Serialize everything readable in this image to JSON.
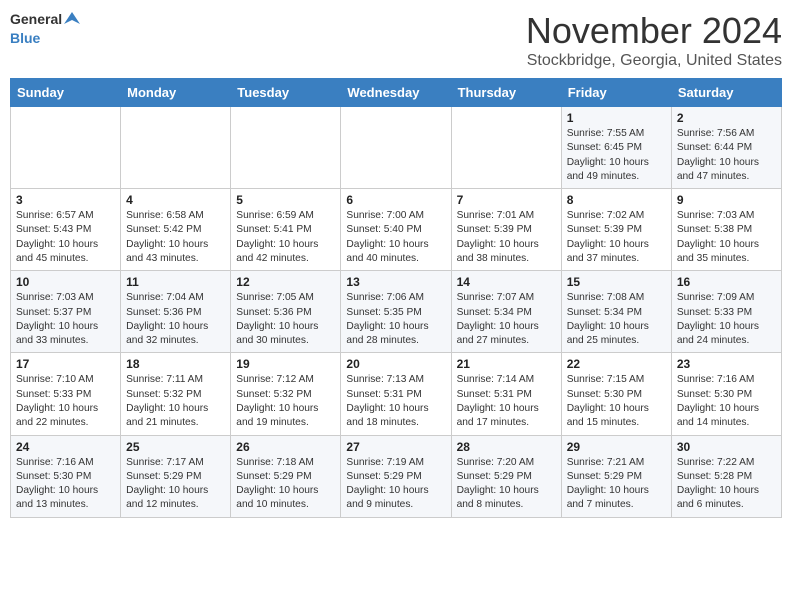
{
  "header": {
    "logo_general": "General",
    "logo_blue": "Blue",
    "month": "November 2024",
    "location": "Stockbridge, Georgia, United States"
  },
  "days_of_week": [
    "Sunday",
    "Monday",
    "Tuesday",
    "Wednesday",
    "Thursday",
    "Friday",
    "Saturday"
  ],
  "weeks": [
    [
      {
        "day": "",
        "info": ""
      },
      {
        "day": "",
        "info": ""
      },
      {
        "day": "",
        "info": ""
      },
      {
        "day": "",
        "info": ""
      },
      {
        "day": "",
        "info": ""
      },
      {
        "day": "1",
        "info": "Sunrise: 7:55 AM\nSunset: 6:45 PM\nDaylight: 10 hours\nand 49 minutes."
      },
      {
        "day": "2",
        "info": "Sunrise: 7:56 AM\nSunset: 6:44 PM\nDaylight: 10 hours\nand 47 minutes."
      }
    ],
    [
      {
        "day": "3",
        "info": "Sunrise: 6:57 AM\nSunset: 5:43 PM\nDaylight: 10 hours\nand 45 minutes."
      },
      {
        "day": "4",
        "info": "Sunrise: 6:58 AM\nSunset: 5:42 PM\nDaylight: 10 hours\nand 43 minutes."
      },
      {
        "day": "5",
        "info": "Sunrise: 6:59 AM\nSunset: 5:41 PM\nDaylight: 10 hours\nand 42 minutes."
      },
      {
        "day": "6",
        "info": "Sunrise: 7:00 AM\nSunset: 5:40 PM\nDaylight: 10 hours\nand 40 minutes."
      },
      {
        "day": "7",
        "info": "Sunrise: 7:01 AM\nSunset: 5:39 PM\nDaylight: 10 hours\nand 38 minutes."
      },
      {
        "day": "8",
        "info": "Sunrise: 7:02 AM\nSunset: 5:39 PM\nDaylight: 10 hours\nand 37 minutes."
      },
      {
        "day": "9",
        "info": "Sunrise: 7:03 AM\nSunset: 5:38 PM\nDaylight: 10 hours\nand 35 minutes."
      }
    ],
    [
      {
        "day": "10",
        "info": "Sunrise: 7:03 AM\nSunset: 5:37 PM\nDaylight: 10 hours\nand 33 minutes."
      },
      {
        "day": "11",
        "info": "Sunrise: 7:04 AM\nSunset: 5:36 PM\nDaylight: 10 hours\nand 32 minutes."
      },
      {
        "day": "12",
        "info": "Sunrise: 7:05 AM\nSunset: 5:36 PM\nDaylight: 10 hours\nand 30 minutes."
      },
      {
        "day": "13",
        "info": "Sunrise: 7:06 AM\nSunset: 5:35 PM\nDaylight: 10 hours\nand 28 minutes."
      },
      {
        "day": "14",
        "info": "Sunrise: 7:07 AM\nSunset: 5:34 PM\nDaylight: 10 hours\nand 27 minutes."
      },
      {
        "day": "15",
        "info": "Sunrise: 7:08 AM\nSunset: 5:34 PM\nDaylight: 10 hours\nand 25 minutes."
      },
      {
        "day": "16",
        "info": "Sunrise: 7:09 AM\nSunset: 5:33 PM\nDaylight: 10 hours\nand 24 minutes."
      }
    ],
    [
      {
        "day": "17",
        "info": "Sunrise: 7:10 AM\nSunset: 5:33 PM\nDaylight: 10 hours\nand 22 minutes."
      },
      {
        "day": "18",
        "info": "Sunrise: 7:11 AM\nSunset: 5:32 PM\nDaylight: 10 hours\nand 21 minutes."
      },
      {
        "day": "19",
        "info": "Sunrise: 7:12 AM\nSunset: 5:32 PM\nDaylight: 10 hours\nand 19 minutes."
      },
      {
        "day": "20",
        "info": "Sunrise: 7:13 AM\nSunset: 5:31 PM\nDaylight: 10 hours\nand 18 minutes."
      },
      {
        "day": "21",
        "info": "Sunrise: 7:14 AM\nSunset: 5:31 PM\nDaylight: 10 hours\nand 17 minutes."
      },
      {
        "day": "22",
        "info": "Sunrise: 7:15 AM\nSunset: 5:30 PM\nDaylight: 10 hours\nand 15 minutes."
      },
      {
        "day": "23",
        "info": "Sunrise: 7:16 AM\nSunset: 5:30 PM\nDaylight: 10 hours\nand 14 minutes."
      }
    ],
    [
      {
        "day": "24",
        "info": "Sunrise: 7:16 AM\nSunset: 5:30 PM\nDaylight: 10 hours\nand 13 minutes."
      },
      {
        "day": "25",
        "info": "Sunrise: 7:17 AM\nSunset: 5:29 PM\nDaylight: 10 hours\nand 12 minutes."
      },
      {
        "day": "26",
        "info": "Sunrise: 7:18 AM\nSunset: 5:29 PM\nDaylight: 10 hours\nand 10 minutes."
      },
      {
        "day": "27",
        "info": "Sunrise: 7:19 AM\nSunset: 5:29 PM\nDaylight: 10 hours\nand 9 minutes."
      },
      {
        "day": "28",
        "info": "Sunrise: 7:20 AM\nSunset: 5:29 PM\nDaylight: 10 hours\nand 8 minutes."
      },
      {
        "day": "29",
        "info": "Sunrise: 7:21 AM\nSunset: 5:29 PM\nDaylight: 10 hours\nand 7 minutes."
      },
      {
        "day": "30",
        "info": "Sunrise: 7:22 AM\nSunset: 5:28 PM\nDaylight: 10 hours\nand 6 minutes."
      }
    ]
  ]
}
